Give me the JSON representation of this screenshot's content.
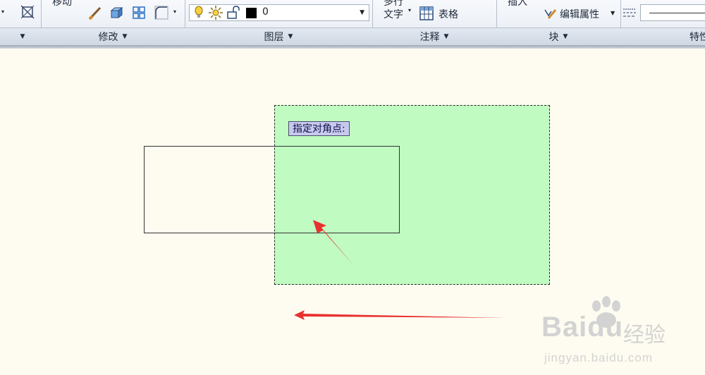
{
  "ribbon": {
    "panels": [
      {
        "title": ""
      },
      {
        "title": "修改",
        "move_label": "移动"
      },
      {
        "title": "图层",
        "layer_value": "0"
      },
      {
        "title": "注释",
        "multiline_text": "多行",
        "text_label": "文字",
        "table_label": "表格"
      },
      {
        "title": "块",
        "insert_label": "插入",
        "edit_attr_label": "编辑属性"
      },
      {
        "title": "特性"
      }
    ]
  },
  "canvas": {
    "prompt": "指定对角点:"
  },
  "watermark": {
    "brand": "Baidu",
    "cn": "经验",
    "url": "jingyan.baidu.com"
  },
  "colors": {
    "background": "#fefcf0",
    "selection_fill": "#c0fbc2",
    "arrow_red": "#e8312f",
    "prompt_bg": "#c8c9ee"
  }
}
